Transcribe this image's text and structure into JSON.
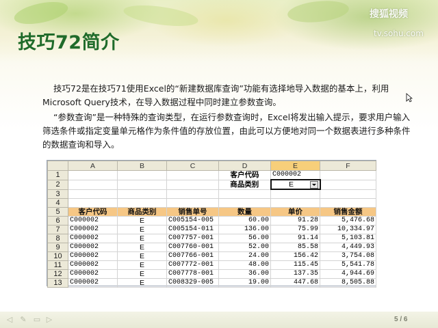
{
  "slide": {
    "title": "技巧72简介",
    "paragraph1": "技巧72是在技巧71使用Excel的“新建数据库查询”功能有选择地导入数据的基本上，利用Microsoft Query技术，在导入数据过程中同时建立参数查询。",
    "paragraph2": "“参数查询”是一种特殊的查询类型，在运行参数查询时，Excel将发出输入提示，要求用户输入筛选条件或指定变量单元格作为条件值的存放位置，由此可以方便地对同一个数据表进行多种条件的数据查询和导入。"
  },
  "logo": {
    "mark": "搜狐视频",
    "site": "tv.sohu.com"
  },
  "spreadsheet": {
    "columns": [
      "A",
      "B",
      "C",
      "D",
      "E",
      "F"
    ],
    "row_numbers": [
      "1",
      "2",
      "3",
      "4",
      "5",
      "6",
      "7",
      "8",
      "9",
      "10",
      "11",
      "12",
      "13"
    ],
    "param_labels": {
      "customer_code": "客户代码",
      "product_category": "商品类别"
    },
    "param_values": {
      "customer_code": "C000002",
      "product_category": "E"
    },
    "headers": [
      "客户代码",
      "商品类别",
      "销售单号",
      "数量",
      "单价",
      "销售金额"
    ],
    "rows": [
      [
        "C000002",
        "E",
        "C005154-005",
        "60.00",
        "91.28",
        "5,476.68"
      ],
      [
        "C000002",
        "E",
        "C005154-011",
        "136.00",
        "75.99",
        "10,334.97"
      ],
      [
        "C000002",
        "E",
        "C007757-001",
        "56.00",
        "91.14",
        "5,103.81"
      ],
      [
        "C000002",
        "E",
        "C007760-001",
        "52.00",
        "85.58",
        "4,449.93"
      ],
      [
        "C000002",
        "E",
        "C007766-001",
        "24.00",
        "156.42",
        "3,754.08"
      ],
      [
        "C000002",
        "E",
        "C007772-001",
        "48.00",
        "115.45",
        "5,541.78"
      ],
      [
        "C000002",
        "E",
        "C007778-001",
        "36.00",
        "137.35",
        "4,944.69"
      ],
      [
        "C000002",
        "E",
        "C008329-005",
        "19.00",
        "447.68",
        "8,505.88"
      ]
    ]
  },
  "footer": {
    "page_indicator": "5 / 6",
    "tool_icons": [
      "arrow-icon",
      "pen-icon",
      "slides-icon",
      "prev-icon",
      "next-icon"
    ]
  },
  "colors": {
    "title": "#1f6b2a",
    "header_fill": "#f6c785",
    "selected_column": "#f7cf7a"
  }
}
